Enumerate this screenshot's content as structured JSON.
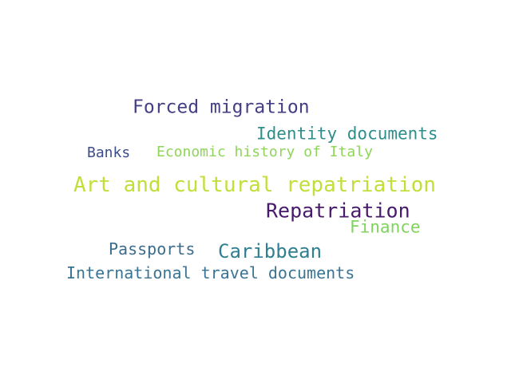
{
  "words": [
    {
      "text": "Forced migration",
      "color": "#433e85"
    },
    {
      "text": "Identity documents",
      "color": "#2d8e8c"
    },
    {
      "text": "Banks",
      "color": "#3b4d8a"
    },
    {
      "text": "Economic history of Italy",
      "color": "#8fd55a"
    },
    {
      "text": "Art and cultural repatriation",
      "color": "#c0df3a"
    },
    {
      "text": "Repatriation",
      "color": "#481a6c"
    },
    {
      "text": "Finance",
      "color": "#7ed45d"
    },
    {
      "text": "Passports",
      "color": "#3c6c8c"
    },
    {
      "text": "Caribbean",
      "color": "#2f7f90"
    },
    {
      "text": "International travel documents",
      "color": "#3a7494"
    }
  ]
}
